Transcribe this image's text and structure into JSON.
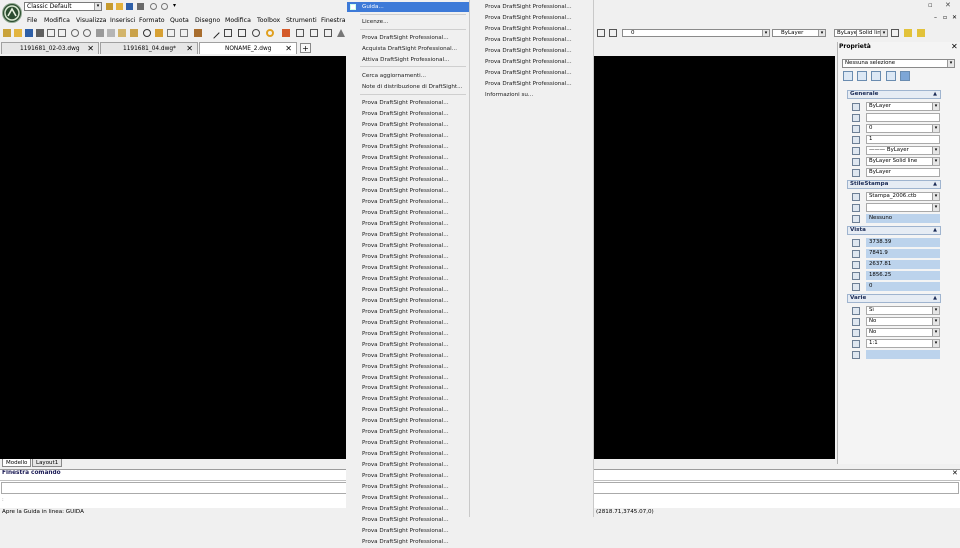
{
  "workspace": {
    "selected": "Classic Default"
  },
  "menubar": [
    "File",
    "Modifica",
    "Visualizza",
    "Inserisci",
    "Formato",
    "Quota",
    "Disegno",
    "Modifica",
    "Toolbox",
    "Strumenti",
    "Finestra"
  ],
  "tabs": [
    {
      "label": "1191681_02-03.dwg"
    },
    {
      "label": "1191681_04.dwg*"
    },
    {
      "label": "NONAME_2.dwg"
    }
  ],
  "tab_add_label": "+",
  "toolbar_right": {
    "layer_value": "0",
    "color_value": "ByLayer",
    "linetype_value": "ByLayer",
    "lineweight_value": "Solid line"
  },
  "layout_tabs": [
    "Modello",
    "Layout1"
  ],
  "help_menu": {
    "highlighted": "Guida...",
    "items": [
      "Licenze...",
      "Prova DraftSight Professional...",
      "Acquista DraftSight Professional...",
      "Attiva DraftSight Professional...",
      "Cerca aggiornamenti...",
      "Note di distribuzione di DraftSight...",
      "Prova DraftSight Professional...",
      "Prova DraftSight Professional...",
      "Prova DraftSight Professional...",
      "Prova DraftSight Professional...",
      "Prova DraftSight Professional...",
      "Prova DraftSight Professional...",
      "Prova DraftSight Professional...",
      "Prova DraftSight Professional...",
      "Prova DraftSight Professional...",
      "Prova DraftSight Professional...",
      "Prova DraftSight Professional...",
      "Prova DraftSight Professional...",
      "Prova DraftSight Professional...",
      "Prova DraftSight Professional...",
      "Prova DraftSight Professional...",
      "Prova DraftSight Professional...",
      "Prova DraftSight Professional...",
      "Prova DraftSight Professional...",
      "Prova DraftSight Professional...",
      "Prova DraftSight Professional...",
      "Prova DraftSight Professional...",
      "Prova DraftSight Professional...",
      "Prova DraftSight Professional...",
      "Prova DraftSight Professional...",
      "Prova DraftSight Professional...",
      "Prova DraftSight Professional...",
      "Prova DraftSight Professional...",
      "Prova DraftSight Professional...",
      "Prova DraftSight Professional...",
      "Prova DraftSight Professional...",
      "Prova DraftSight Professional...",
      "Prova DraftSight Professional...",
      "Prova DraftSight Professional...",
      "Prova DraftSight Professional...",
      "Prova DraftSight Professional...",
      "Prova DraftSight Professional...",
      "Prova DraftSight Professional...",
      "Prova DraftSight Professional...",
      "Prova DraftSight Professional...",
      "Prova DraftSight Professional...",
      "Prova DraftSight Professional..."
    ]
  },
  "submenu": {
    "items": [
      "Prova DraftSight Professional...",
      "Prova DraftSight Professional...",
      "Prova DraftSight Professional...",
      "Prova DraftSight Professional...",
      "Prova DraftSight Professional...",
      "Prova DraftSight Professional...",
      "Prova DraftSight Professional...",
      "Prova DraftSight Professional...",
      "Informazioni su..."
    ]
  },
  "properties": {
    "title": "Proprietà",
    "selection": "Nessuna selezione",
    "sections": [
      {
        "title": "Generale",
        "rows": [
          {
            "icon": "color-icon",
            "value": "ByLayer",
            "dropdown": true,
            "hl": false
          },
          {
            "icon": "layer-icon",
            "value": "",
            "dropdown": false,
            "hl": false
          },
          {
            "icon": "layer-state-icon",
            "value": "0",
            "dropdown": true,
            "hl": false
          },
          {
            "icon": "linetype-scale-icon",
            "value": "1",
            "dropdown": false,
            "hl": false
          },
          {
            "icon": "linetype-icon",
            "value": "——— ByLayer",
            "dropdown": true,
            "hl": false
          },
          {
            "icon": "lineweight-icon",
            "value": "ByLayer     Solid line",
            "dropdown": true,
            "hl": false
          },
          {
            "icon": "transparency-icon",
            "value": "ByLayer",
            "dropdown": false,
            "hl": false
          }
        ]
      },
      {
        "title": "StileStampa",
        "rows": [
          {
            "icon": "print-style-icon",
            "value": "Stampa_2006.ctb",
            "dropdown": true,
            "hl": false
          },
          {
            "icon": "print-table-icon",
            "value": "",
            "dropdown": true,
            "hl": false
          },
          {
            "icon": "print-attached-icon",
            "value": "Nessuno",
            "dropdown": false,
            "hl": true
          }
        ]
      },
      {
        "title": "Vista",
        "rows": [
          {
            "icon": "height-icon",
            "value": "3738.39",
            "dropdown": false,
            "hl": true
          },
          {
            "icon": "width-icon",
            "value": "7841.9",
            "dropdown": false,
            "hl": true
          },
          {
            "icon": "center-x-icon",
            "value": "2637.81",
            "dropdown": false,
            "hl": true
          },
          {
            "icon": "center-y-icon",
            "value": "1856.25",
            "dropdown": false,
            "hl": true
          },
          {
            "icon": "center-z-icon",
            "value": "0",
            "dropdown": false,
            "hl": true
          }
        ]
      },
      {
        "title": "Varie",
        "rows": [
          {
            "icon": "ucs-icon",
            "value": "Sì",
            "dropdown": true,
            "hl": false
          },
          {
            "icon": "ucs-origin-icon",
            "value": "No",
            "dropdown": true,
            "hl": false
          },
          {
            "icon": "ucs-view-icon",
            "value": "No",
            "dropdown": true,
            "hl": false
          },
          {
            "icon": "annotation-scale-icon",
            "value": "1:1",
            "dropdown": true,
            "hl": false
          },
          {
            "icon": "visual-style-icon",
            "value": "",
            "dropdown": false,
            "hl": true
          }
        ]
      }
    ]
  },
  "command_window": {
    "title": "Finestra comando",
    "hint": ":"
  },
  "status": {
    "text": "Apre la Guida in linea:  GUIDA",
    "coords": "(2818.71,3745.07,0)"
  },
  "colors": {
    "menu_highlight": "#3d7ad8",
    "panel_highlight": "#bcd3ec",
    "canvas": "#000000"
  }
}
